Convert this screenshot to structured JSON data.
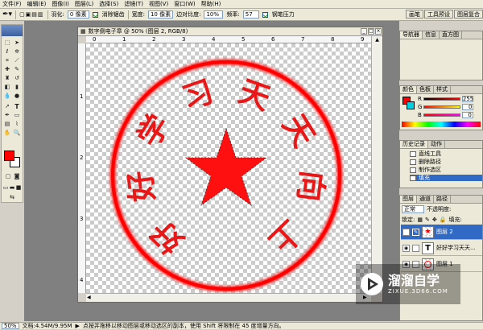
{
  "menu": [
    "文件(F)",
    "编辑(E)",
    "图像(I)",
    "图层(L)",
    "选择(S)",
    "滤镜(T)",
    "视图(V)",
    "窗口(W)",
    "帮助(H)"
  ],
  "options": {
    "feather_label": "羽化:",
    "feather_value": "0 像素",
    "antialias_label": "消除锯齿",
    "width_label": "宽度:",
    "width_value": "10 像素",
    "edge_contrast_label": "边对比度:",
    "edge_contrast_value": "10%",
    "frequency_label": "频率:",
    "frequency_value": "57",
    "pen_pressure_label": "钢笔压力"
  },
  "top_panel_tabs": [
    "画笔",
    "工具预设",
    "图层复合"
  ],
  "document": {
    "title": "数字倒电子章 @ 50% (图层 2, RGB/8)",
    "ruler_top": [
      "0",
      "1",
      "2",
      "3",
      "4",
      "5",
      "6",
      "7",
      "8",
      "9"
    ],
    "ruler_left": [
      "1",
      "2",
      "3",
      "4"
    ]
  },
  "seal": {
    "characters": [
      "好",
      "好",
      "学",
      "习",
      "天",
      "天",
      "向",
      "上"
    ],
    "color": "#ff1010"
  },
  "navigator_tabs": [
    "导航器",
    "信息",
    "直方图"
  ],
  "color_panel": {
    "tabs": [
      "颜色",
      "色板",
      "样式"
    ],
    "r_label": "R",
    "r_value": "255",
    "g_label": "G",
    "g_value": "0",
    "b_label": "B",
    "b_value": "0"
  },
  "history_panel": {
    "tabs": [
      "历史记录",
      "动作"
    ],
    "items": [
      "直线工具",
      "删除路径",
      "制作选区",
      "填充"
    ]
  },
  "layers_panel": {
    "tabs": [
      "图层",
      "通道",
      "路径"
    ],
    "blend_mode": "正常",
    "opacity_label": "不透明度:",
    "lock_label": "锁定:",
    "fill_label": "填充:",
    "layers": [
      {
        "name": "图层 2",
        "type": "image",
        "selected": true
      },
      {
        "name": "好好学习天天...",
        "type": "text",
        "selected": false
      },
      {
        "name": "图层 1",
        "type": "image",
        "selected": false
      }
    ]
  },
  "status": {
    "zoom": "50%",
    "doc_size": "文档:4.54M/9.95M",
    "hint": "点按并拖移以移动图层或移动选区的副本，使用 Shift 将限制在 45 度增量方向。"
  },
  "watermark": {
    "title": "溜溜自学",
    "url": "ZIXUE.3D66.COM"
  }
}
